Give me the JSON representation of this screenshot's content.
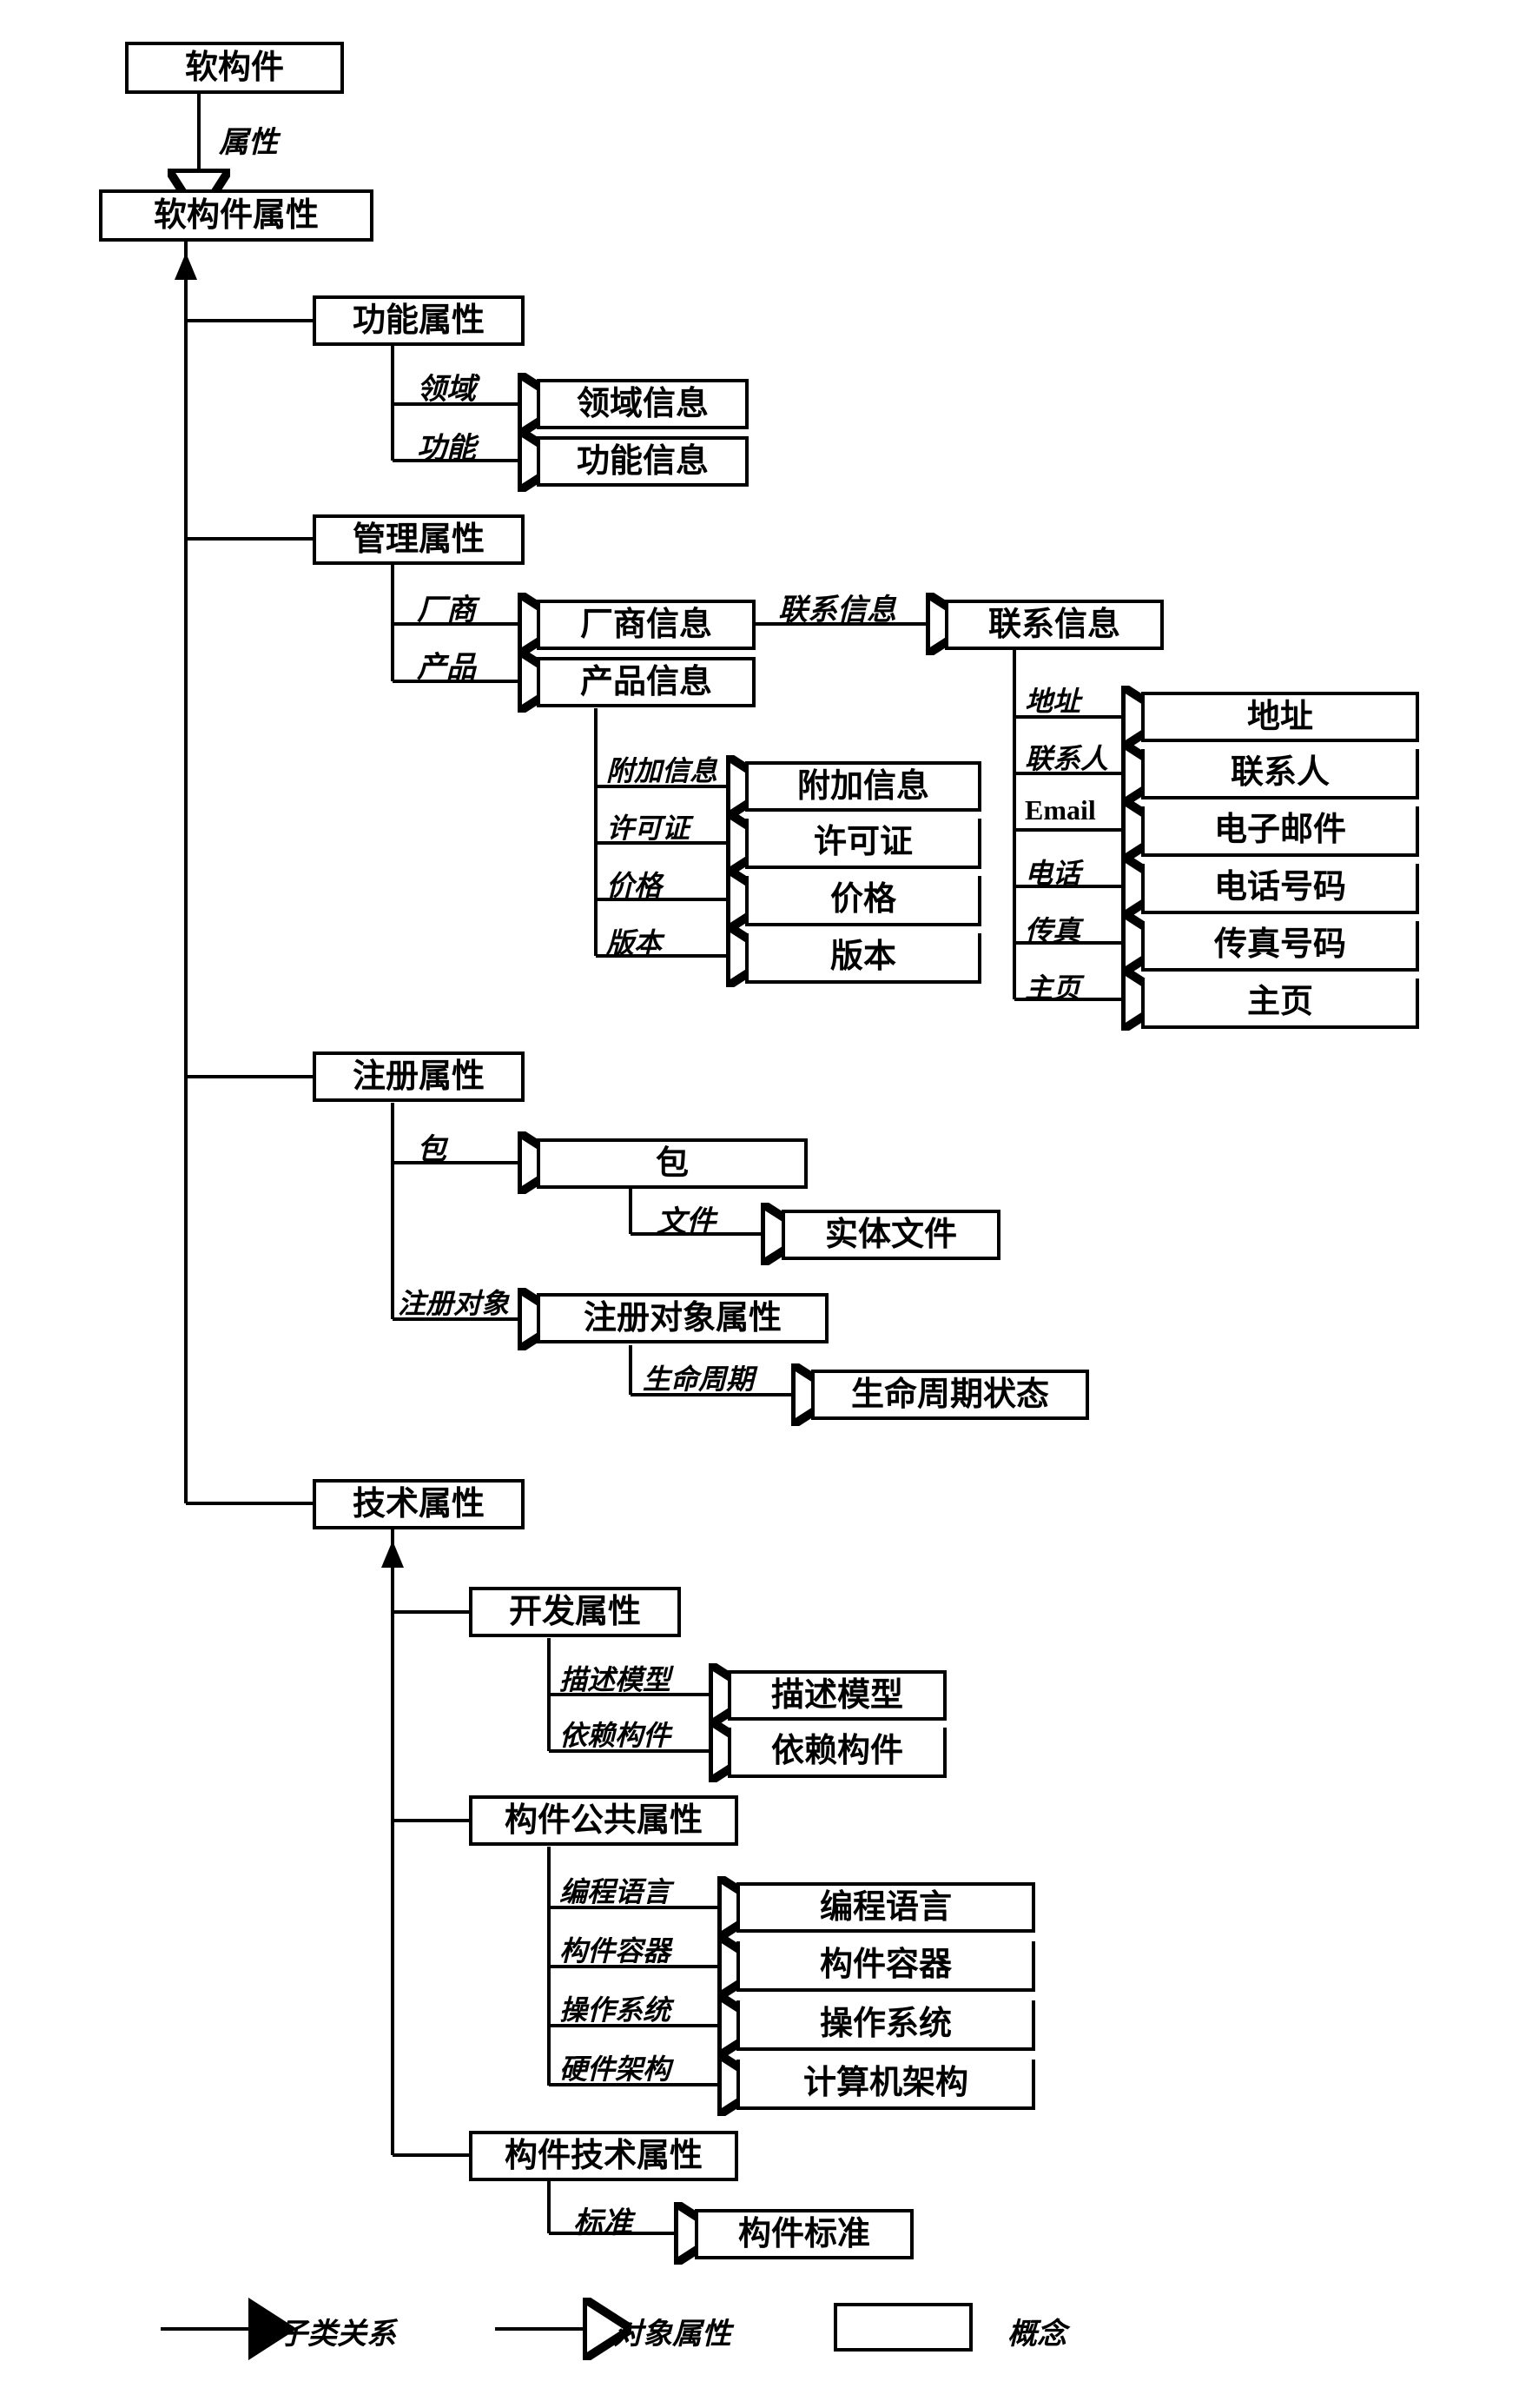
{
  "root": "软构件",
  "root_attr_label": "属性",
  "root_attr": "软构件属性",
  "func_attr": "功能属性",
  "func_domain_lbl": "领域",
  "func_domain": "领域信息",
  "func_func_lbl": "功能",
  "func_func": "功能信息",
  "mgmt_attr": "管理属性",
  "mgmt_vendor_lbl": "厂商",
  "mgmt_vendor": "厂商信息",
  "mgmt_product_lbl": "产品",
  "mgmt_product": "产品信息",
  "mgmt_contact_lbl": "联系信息",
  "mgmt_contact": "联系信息",
  "prod_addl_lbl": "附加信息",
  "prod_addl": "附加信息",
  "prod_license_lbl": "许可证",
  "prod_license": "许可证",
  "prod_price_lbl": "价格",
  "prod_price": "价格",
  "prod_version_lbl": "版本",
  "prod_version": "版本",
  "contact_addr_lbl": "地址",
  "contact_addr": "地址",
  "contact_person_lbl": "联系人",
  "contact_person": "联系人",
  "contact_email_lbl": "Email",
  "contact_email": "电子邮件",
  "contact_phone_lbl": "电话",
  "contact_phone": "电话号码",
  "contact_fax_lbl": "传真",
  "contact_fax": "传真号码",
  "contact_home_lbl": "主页",
  "contact_home": "主页",
  "reg_attr": "注册属性",
  "reg_pkg_lbl": "包",
  "reg_pkg": "包",
  "reg_file_lbl": "文件",
  "reg_file": "实体文件",
  "reg_obj_lbl": "注册对象",
  "reg_obj": "注册对象属性",
  "reg_life_lbl": "生命周期",
  "reg_life": "生命周期状态",
  "tech_attr": "技术属性",
  "dev_attr": "开发属性",
  "dev_model_lbl": "描述模型",
  "dev_model": "描述模型",
  "dev_dep_lbl": "依赖构件",
  "dev_dep": "依赖构件",
  "pub_attr": "构件公共属性",
  "pub_lang_lbl": "编程语言",
  "pub_lang": "编程语言",
  "pub_container_lbl": "构件容器",
  "pub_container": "构件容器",
  "pub_os_lbl": "操作系统",
  "pub_os": "操作系统",
  "pub_hw_lbl": "硬件架构",
  "pub_hw": "计算机架构",
  "comp_tech_attr": "构件技术属性",
  "comp_std_lbl": "标准",
  "comp_std": "构件标准",
  "legend_subclass": "子类关系",
  "legend_objprop": "对象属性",
  "legend_concept": "概念"
}
